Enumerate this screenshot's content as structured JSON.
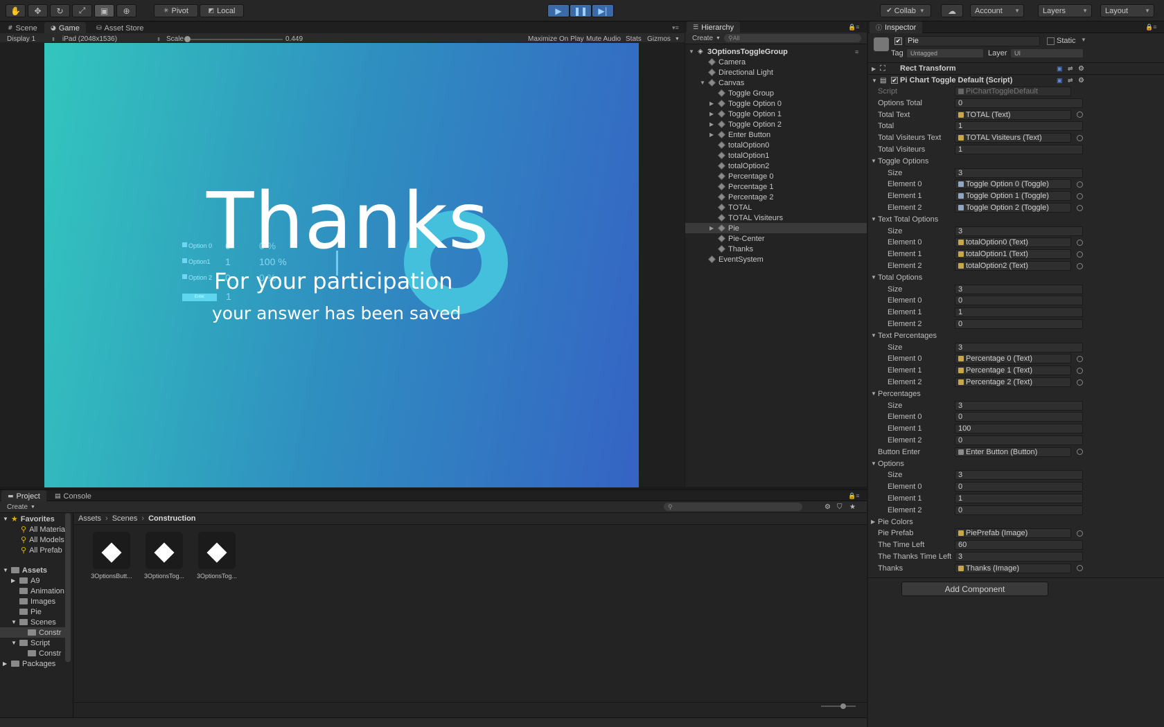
{
  "toolbar": {
    "pivot": "Pivot",
    "local": "Local",
    "collab": "Collab",
    "account": "Account",
    "layers": "Layers",
    "layout": "Layout"
  },
  "scene_tabs": [
    "Scene",
    "Game",
    "Asset Store"
  ],
  "game_bar": {
    "display": "Display 1",
    "resolution": "iPad (2048x1536)",
    "scale_label": "Scale",
    "scale_value": "0.449",
    "maximize": "Maximize On Play",
    "mute": "Mute Audio",
    "stats": "Stats",
    "gizmos": "Gizmos"
  },
  "game": {
    "title": "Thanks",
    "line1": "For your participation",
    "line2": "your answer has been saved",
    "options": [
      {
        "label": "Option 0",
        "total": "0",
        "percent": "0 %"
      },
      {
        "label": "Option1",
        "total": "1",
        "percent": "100 %"
      },
      {
        "label": "Option 2",
        "total": "0",
        "percent": "0 %"
      }
    ],
    "enter": "Enter",
    "total": "1"
  },
  "hierarchy": {
    "tab": "Hierarchy",
    "create": "Create",
    "search_placeholder": "All",
    "root": "3OptionsToggleGroup",
    "items": [
      {
        "label": "Camera",
        "indent": 1,
        "fold": false
      },
      {
        "label": "Directional Light",
        "indent": 1,
        "fold": false
      },
      {
        "label": "Canvas",
        "indent": 1,
        "fold": true,
        "open": true
      },
      {
        "label": "Toggle Group",
        "indent": 2,
        "fold": false
      },
      {
        "label": "Toggle Option 0",
        "indent": 2,
        "fold": true
      },
      {
        "label": "Toggle Option 1",
        "indent": 2,
        "fold": true
      },
      {
        "label": "Toggle Option 2",
        "indent": 2,
        "fold": true
      },
      {
        "label": "Enter Button",
        "indent": 2,
        "fold": true
      },
      {
        "label": "totalOption0",
        "indent": 2,
        "fold": false
      },
      {
        "label": "totalOption1",
        "indent": 2,
        "fold": false
      },
      {
        "label": "totalOption2",
        "indent": 2,
        "fold": false
      },
      {
        "label": "Percentage 0",
        "indent": 2,
        "fold": false
      },
      {
        "label": "Percentage 1",
        "indent": 2,
        "fold": false
      },
      {
        "label": "Percentage 2",
        "indent": 2,
        "fold": false
      },
      {
        "label": "TOTAL",
        "indent": 2,
        "fold": false
      },
      {
        "label": "TOTAL Visiteurs",
        "indent": 2,
        "fold": false
      },
      {
        "label": "Pie",
        "indent": 2,
        "fold": true,
        "selected": true
      },
      {
        "label": "Pie-Center",
        "indent": 2,
        "fold": false
      },
      {
        "label": "Thanks",
        "indent": 2,
        "fold": false
      },
      {
        "label": "EventSystem",
        "indent": 1,
        "fold": false
      }
    ]
  },
  "inspector": {
    "tab": "Inspector",
    "object_name": "Pie",
    "static": "Static",
    "tag_label": "Tag",
    "tag_value": "Untagged",
    "layer_label": "Layer",
    "layer_value": "UI",
    "rect_transform": "Rect Transform",
    "script_component": "Pi Chart Toggle Default (Script)",
    "add_component": "Add Component",
    "rows": [
      {
        "label": "Script",
        "value": "PiChartToggleDefault",
        "kind": "script",
        "indent": 0
      },
      {
        "label": "Options Total",
        "value": "0",
        "kind": "num",
        "indent": 0
      },
      {
        "label": "Total Text",
        "value": "TOTAL (Text)",
        "kind": "obj",
        "indent": 0
      },
      {
        "label": "Total",
        "value": "1",
        "kind": "num",
        "indent": 0
      },
      {
        "label": "Total Visiteurs Text",
        "value": "TOTAL Visiteurs (Text)",
        "kind": "obj",
        "indent": 0
      },
      {
        "label": "Total Visiteurs",
        "value": "1",
        "kind": "num",
        "indent": 0
      },
      {
        "label": "Toggle Options",
        "value": "",
        "kind": "section",
        "indent": 0
      },
      {
        "label": "Size",
        "value": "3",
        "kind": "num",
        "indent": 1
      },
      {
        "label": "Element 0",
        "value": "Toggle Option 0 (Toggle)",
        "kind": "toggle",
        "indent": 1
      },
      {
        "label": "Element 1",
        "value": "Toggle Option 1 (Toggle)",
        "kind": "toggle",
        "indent": 1
      },
      {
        "label": "Element 2",
        "value": "Toggle Option 2 (Toggle)",
        "kind": "toggle",
        "indent": 1
      },
      {
        "label": "Text Total Options",
        "value": "",
        "kind": "section",
        "indent": 0
      },
      {
        "label": "Size",
        "value": "3",
        "kind": "num",
        "indent": 1
      },
      {
        "label": "Element 0",
        "value": "totalOption0 (Text)",
        "kind": "obj",
        "indent": 1
      },
      {
        "label": "Element 1",
        "value": "totalOption1 (Text)",
        "kind": "obj",
        "indent": 1
      },
      {
        "label": "Element 2",
        "value": "totalOption2 (Text)",
        "kind": "obj",
        "indent": 1
      },
      {
        "label": "Total Options",
        "value": "",
        "kind": "section",
        "indent": 0
      },
      {
        "label": "Size",
        "value": "3",
        "kind": "num",
        "indent": 1
      },
      {
        "label": "Element 0",
        "value": "0",
        "kind": "num",
        "indent": 1
      },
      {
        "label": "Element 1",
        "value": "1",
        "kind": "num",
        "indent": 1
      },
      {
        "label": "Element 2",
        "value": "0",
        "kind": "num",
        "indent": 1
      },
      {
        "label": "Text Percentages",
        "value": "",
        "kind": "section",
        "indent": 0
      },
      {
        "label": "Size",
        "value": "3",
        "kind": "num",
        "indent": 1
      },
      {
        "label": "Element 0",
        "value": "Percentage 0 (Text)",
        "kind": "obj",
        "indent": 1
      },
      {
        "label": "Element 1",
        "value": "Percentage 1 (Text)",
        "kind": "obj",
        "indent": 1
      },
      {
        "label": "Element 2",
        "value": "Percentage 2 (Text)",
        "kind": "obj",
        "indent": 1
      },
      {
        "label": "Percentages",
        "value": "",
        "kind": "section",
        "indent": 0
      },
      {
        "label": "Size",
        "value": "3",
        "kind": "num",
        "indent": 1
      },
      {
        "label": "Element 0",
        "value": "0",
        "kind": "num",
        "indent": 1
      },
      {
        "label": "Element 1",
        "value": "100",
        "kind": "num",
        "indent": 1
      },
      {
        "label": "Element 2",
        "value": "0",
        "kind": "num",
        "indent": 1
      },
      {
        "label": "Button Enter",
        "value": "Enter Button (Button)",
        "kind": "button",
        "indent": 0
      },
      {
        "label": "Options",
        "value": "",
        "kind": "section",
        "indent": 0
      },
      {
        "label": "Size",
        "value": "3",
        "kind": "num",
        "indent": 1
      },
      {
        "label": "Element 0",
        "value": "0",
        "kind": "num",
        "indent": 1
      },
      {
        "label": "Element 1",
        "value": "1",
        "kind": "num",
        "indent": 1
      },
      {
        "label": "Element 2",
        "value": "0",
        "kind": "num",
        "indent": 1
      },
      {
        "label": "Pie Colors",
        "value": "",
        "kind": "section-closed",
        "indent": 0
      },
      {
        "label": "Pie Prefab",
        "value": "PiePrefab (Image)",
        "kind": "image",
        "indent": 0
      },
      {
        "label": "The Time Left",
        "value": "60",
        "kind": "num",
        "indent": 0
      },
      {
        "label": "The Thanks Time Left",
        "value": "3",
        "kind": "num",
        "indent": 0
      },
      {
        "label": "Thanks",
        "value": "Thanks (Image)",
        "kind": "image",
        "indent": 0
      }
    ]
  },
  "project": {
    "tabs": [
      "Project",
      "Console"
    ],
    "create": "Create",
    "breadcrumb": [
      "Assets",
      "Scenes",
      "Construction"
    ],
    "favorites_label": "Favorites",
    "favorites": [
      "All Materia",
      "All Models",
      "All Prefab"
    ],
    "assets_label": "Assets",
    "tree": [
      {
        "label": "A9",
        "indent": 1,
        "fold": true
      },
      {
        "label": "Animation",
        "indent": 1,
        "fold": false
      },
      {
        "label": "Images",
        "indent": 1,
        "fold": false
      },
      {
        "label": "Pie",
        "indent": 1,
        "fold": false
      },
      {
        "label": "Scenes",
        "indent": 1,
        "fold": true,
        "open": true
      },
      {
        "label": "Constr",
        "indent": 2,
        "fold": false,
        "selected": true
      },
      {
        "label": "Script",
        "indent": 1,
        "fold": true,
        "open": true
      },
      {
        "label": "Constr",
        "indent": 2,
        "fold": false
      },
      {
        "label": "Packages",
        "indent": 0,
        "fold": true
      }
    ],
    "assets": [
      "3OptionsButt...",
      "3OptionsTog...",
      "3OptionsTog..."
    ]
  },
  "colors": {
    "accent": "#3a6aa7",
    "game_gradient_start": "#33c6bd",
    "game_gradient_end": "#3563c4"
  }
}
